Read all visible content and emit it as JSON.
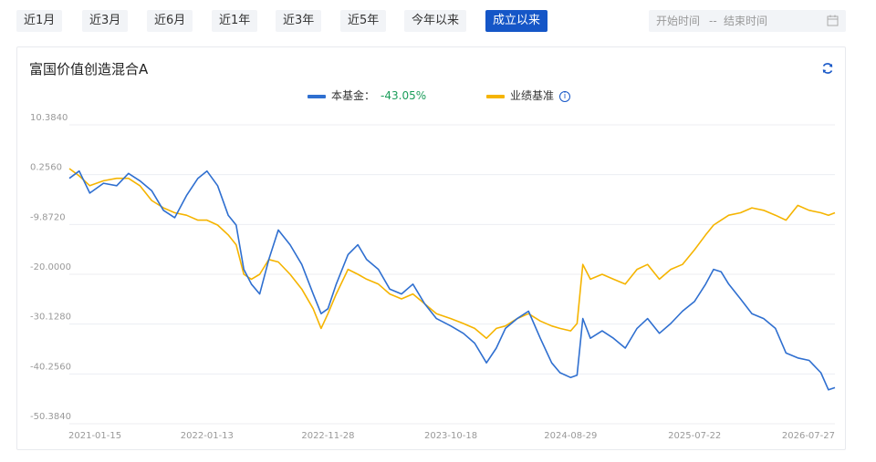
{
  "ranges": [
    "近1月",
    "近3月",
    "近6月",
    "近1年",
    "近3年",
    "近5年",
    "今年以来",
    "成立以来"
  ],
  "active_range": "成立以来",
  "date_picker": {
    "start_placeholder": "开始时间",
    "separator": "--",
    "end_placeholder": "结束时间"
  },
  "fund_name": "富国价值创造混合A",
  "colors": {
    "fund": "#2f6fd0",
    "benchmark": "#f5b400",
    "accent": "#1556c7",
    "positive": "#1a9d5a"
  },
  "icons": {
    "refresh": "refresh-icon",
    "calendar": "calendar-icon",
    "info": "info-icon"
  },
  "chart_data": {
    "type": "line",
    "title": "",
    "xlabel": "",
    "ylabel": "",
    "ylim": [
      -50.384,
      10.384
    ],
    "y_ticks": [
      "10.3840",
      "0.2560",
      "-9.8720",
      "-20.0000",
      "-30.1280",
      "-40.2560",
      "-50.3840"
    ],
    "x_ticks": [
      "2021-01-15",
      "2022-01-13",
      "2022-11-28",
      "2023-10-18",
      "2024-08-29",
      "2025-07-22",
      "2026-07-27"
    ],
    "grid": true,
    "legend_position": "top-center",
    "series": [
      {
        "name": "本基金",
        "display_value": "-43.05%",
        "points": [
          [
            "2021-01-15",
            -0.5
          ],
          [
            "2021-02-10",
            1.0
          ],
          [
            "2021-03-10",
            -3.5
          ],
          [
            "2021-04-15",
            -1.5
          ],
          [
            "2021-05-20",
            -2.0
          ],
          [
            "2021-06-20",
            0.5
          ],
          [
            "2021-07-20",
            -1.0
          ],
          [
            "2021-08-20",
            -3.0
          ],
          [
            "2021-09-20",
            -7.0
          ],
          [
            "2021-10-20",
            -8.5
          ],
          [
            "2021-11-20",
            -4.0
          ],
          [
            "2021-12-20",
            -0.5
          ],
          [
            "2022-01-13",
            1.0
          ],
          [
            "2022-02-10",
            -2.0
          ],
          [
            "2022-03-10",
            -8.0
          ],
          [
            "2022-03-31",
            -10.0
          ],
          [
            "2022-04-20",
            -19.0
          ],
          [
            "2022-05-10",
            -22.0
          ],
          [
            "2022-06-01",
            -24.0
          ],
          [
            "2022-06-25",
            -17.0
          ],
          [
            "2022-07-20",
            -11.0
          ],
          [
            "2022-08-20",
            -14.0
          ],
          [
            "2022-09-20",
            -18.0
          ],
          [
            "2022-10-20",
            -24.0
          ],
          [
            "2022-11-10",
            -28.0
          ],
          [
            "2022-11-28",
            -27.0
          ],
          [
            "2022-12-20",
            -22.0
          ],
          [
            "2023-01-20",
            -16.0
          ],
          [
            "2023-02-15",
            -14.0
          ],
          [
            "2023-03-10",
            -17.0
          ],
          [
            "2023-04-10",
            -19.0
          ],
          [
            "2023-05-10",
            -23.0
          ],
          [
            "2023-06-10",
            -24.0
          ],
          [
            "2023-07-10",
            -22.0
          ],
          [
            "2023-08-10",
            -26.0
          ],
          [
            "2023-09-10",
            -29.0
          ],
          [
            "2023-10-18",
            -30.5
          ],
          [
            "2023-11-20",
            -32.0
          ],
          [
            "2023-12-20",
            -34.0
          ],
          [
            "2024-01-20",
            -38.0
          ],
          [
            "2024-02-15",
            -35.0
          ],
          [
            "2024-03-10",
            -31.0
          ],
          [
            "2024-04-10",
            -29.0
          ],
          [
            "2024-05-10",
            -27.5
          ],
          [
            "2024-06-10",
            -33.0
          ],
          [
            "2024-07-10",
            -38.0
          ],
          [
            "2024-08-01",
            -40.0
          ],
          [
            "2024-08-29",
            -41.0
          ],
          [
            "2024-09-15",
            -40.5
          ],
          [
            "2024-09-30",
            -29.0
          ],
          [
            "2024-10-20",
            -33.0
          ],
          [
            "2024-11-20",
            -31.5
          ],
          [
            "2024-12-20",
            -33.0
          ],
          [
            "2025-01-20",
            -35.0
          ],
          [
            "2025-02-20",
            -31.0
          ],
          [
            "2025-03-20",
            -29.0
          ],
          [
            "2025-04-20",
            -32.0
          ],
          [
            "2025-05-20",
            -30.0
          ],
          [
            "2025-06-20",
            -27.5
          ],
          [
            "2025-07-22",
            -25.5
          ],
          [
            "2025-08-20",
            -22.0
          ],
          [
            "2025-09-10",
            -19.0
          ],
          [
            "2025-09-30",
            -19.5
          ],
          [
            "2025-10-20",
            -22.0
          ],
          [
            "2025-11-20",
            -25.0
          ],
          [
            "2025-12-20",
            -28.0
          ],
          [
            "2026-01-20",
            -29.0
          ],
          [
            "2026-02-20",
            -31.0
          ],
          [
            "2026-03-20",
            -36.0
          ],
          [
            "2026-04-20",
            -37.0
          ],
          [
            "2026-05-20",
            -37.5
          ],
          [
            "2026-06-20",
            -40.0
          ],
          [
            "2026-07-10",
            -43.5
          ],
          [
            "2026-07-27",
            -43.05
          ]
        ]
      },
      {
        "name": "业绩基准",
        "points": [
          [
            "2021-01-15",
            1.5
          ],
          [
            "2021-02-10",
            0.0
          ],
          [
            "2021-03-10",
            -2.0
          ],
          [
            "2021-04-15",
            -1.0
          ],
          [
            "2021-05-20",
            -0.5
          ],
          [
            "2021-06-20",
            -0.5
          ],
          [
            "2021-07-20",
            -2.0
          ],
          [
            "2021-08-20",
            -5.0
          ],
          [
            "2021-09-20",
            -6.5
          ],
          [
            "2021-10-20",
            -7.5
          ],
          [
            "2021-11-20",
            -8.0
          ],
          [
            "2021-12-20",
            -9.0
          ],
          [
            "2022-01-13",
            -9.0
          ],
          [
            "2022-02-10",
            -10.0
          ],
          [
            "2022-03-10",
            -12.0
          ],
          [
            "2022-03-31",
            -14.0
          ],
          [
            "2022-04-20",
            -20.0
          ],
          [
            "2022-05-10",
            -21.0
          ],
          [
            "2022-06-01",
            -20.0
          ],
          [
            "2022-06-25",
            -17.0
          ],
          [
            "2022-07-20",
            -17.5
          ],
          [
            "2022-08-20",
            -20.0
          ],
          [
            "2022-09-20",
            -23.0
          ],
          [
            "2022-10-20",
            -27.0
          ],
          [
            "2022-11-10",
            -31.0
          ],
          [
            "2022-11-28",
            -28.0
          ],
          [
            "2022-12-20",
            -24.0
          ],
          [
            "2023-01-20",
            -19.0
          ],
          [
            "2023-02-15",
            -20.0
          ],
          [
            "2023-03-10",
            -21.0
          ],
          [
            "2023-04-10",
            -22.0
          ],
          [
            "2023-05-10",
            -24.0
          ],
          [
            "2023-06-10",
            -25.0
          ],
          [
            "2023-07-10",
            -24.0
          ],
          [
            "2023-08-10",
            -26.0
          ],
          [
            "2023-09-10",
            -28.0
          ],
          [
            "2023-10-18",
            -29.0
          ],
          [
            "2023-11-20",
            -30.0
          ],
          [
            "2023-12-20",
            -31.0
          ],
          [
            "2024-01-20",
            -33.0
          ],
          [
            "2024-02-15",
            -31.0
          ],
          [
            "2024-03-10",
            -30.5
          ],
          [
            "2024-04-10",
            -29.0
          ],
          [
            "2024-05-10",
            -28.0
          ],
          [
            "2024-06-10",
            -29.5
          ],
          [
            "2024-07-10",
            -30.5
          ],
          [
            "2024-08-01",
            -31.0
          ],
          [
            "2024-08-29",
            -31.5
          ],
          [
            "2024-09-15",
            -30.0
          ],
          [
            "2024-09-30",
            -18.0
          ],
          [
            "2024-10-20",
            -21.0
          ],
          [
            "2024-11-20",
            -20.0
          ],
          [
            "2024-12-20",
            -21.0
          ],
          [
            "2025-01-20",
            -22.0
          ],
          [
            "2025-02-20",
            -19.0
          ],
          [
            "2025-03-20",
            -18.0
          ],
          [
            "2025-04-20",
            -21.0
          ],
          [
            "2025-05-20",
            -19.0
          ],
          [
            "2025-06-20",
            -18.0
          ],
          [
            "2025-07-22",
            -15.0
          ],
          [
            "2025-08-20",
            -12.0
          ],
          [
            "2025-09-10",
            -10.0
          ],
          [
            "2025-09-30",
            -9.0
          ],
          [
            "2025-10-20",
            -8.0
          ],
          [
            "2025-11-20",
            -7.5
          ],
          [
            "2025-12-20",
            -6.5
          ],
          [
            "2026-01-20",
            -7.0
          ],
          [
            "2026-02-20",
            -8.0
          ],
          [
            "2026-03-20",
            -9.0
          ],
          [
            "2026-04-20",
            -6.0
          ],
          [
            "2026-05-20",
            -7.0
          ],
          [
            "2026-06-20",
            -7.5
          ],
          [
            "2026-07-10",
            -8.0
          ],
          [
            "2026-07-27",
            -7.5
          ]
        ]
      }
    ]
  }
}
